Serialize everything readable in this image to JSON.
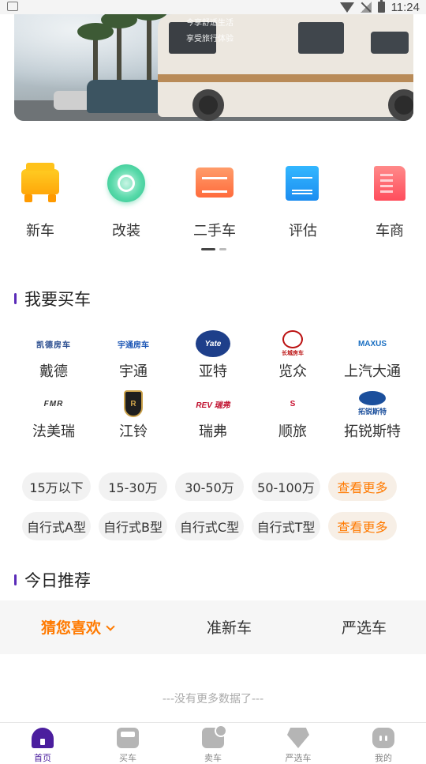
{
  "status_bar": {
    "time": "11:24"
  },
  "banner": {
    "caption_line1": "今享舒适生活",
    "caption_line2": "享受旅行体验"
  },
  "quick_nav": [
    {
      "label": "新车",
      "icon": "new-car-icon"
    },
    {
      "label": "改装",
      "icon": "modify-wheel-icon"
    },
    {
      "label": "二手车",
      "icon": "used-car-icon"
    },
    {
      "label": "评估",
      "icon": "evaluate-document-icon"
    },
    {
      "label": "车商",
      "icon": "dealer-building-icon"
    }
  ],
  "buy_section": {
    "title": "我要买车",
    "brands": [
      {
        "name": "戴德",
        "logo_text": "凯德房车"
      },
      {
        "name": "宇通",
        "logo_text": "宇通房车"
      },
      {
        "name": "亚特",
        "logo_text": "Yate"
      },
      {
        "name": "览众",
        "logo_text": "长城房车"
      },
      {
        "name": "上汽大通",
        "logo_text": "MAXUS"
      },
      {
        "name": "法美瑞",
        "logo_text": "FMR"
      },
      {
        "name": "江铃",
        "logo_text": "R"
      },
      {
        "name": "瑞弗",
        "logo_text": "REV 瑞弗"
      },
      {
        "name": "顺旅",
        "logo_text": "S"
      },
      {
        "name": "拓锐斯特",
        "logo_text": "拓锐斯特"
      }
    ],
    "price_filters": [
      "15万以下",
      "15-30万",
      "30-50万",
      "50-100万"
    ],
    "type_filters": [
      "自行式A型",
      "自行式B型",
      "自行式C型",
      "自行式T型"
    ],
    "more_label": "查看更多"
  },
  "recommend_section": {
    "title": "今日推荐",
    "tabs": [
      "猜您喜欢",
      "准新车",
      "严选车"
    ],
    "active_tab": 0,
    "empty_text": "---没有更多数据了---"
  },
  "bottom_nav": [
    {
      "label": "首页",
      "active": true
    },
    {
      "label": "买车",
      "active": false
    },
    {
      "label": "卖车",
      "active": false
    },
    {
      "label": "严选车",
      "active": false
    },
    {
      "label": "我的",
      "active": false
    }
  ],
  "colors": {
    "accent_purple": "#4b1e9e",
    "accent_orange": "#ff7a00",
    "chip_bg": "#f2f2f2"
  }
}
